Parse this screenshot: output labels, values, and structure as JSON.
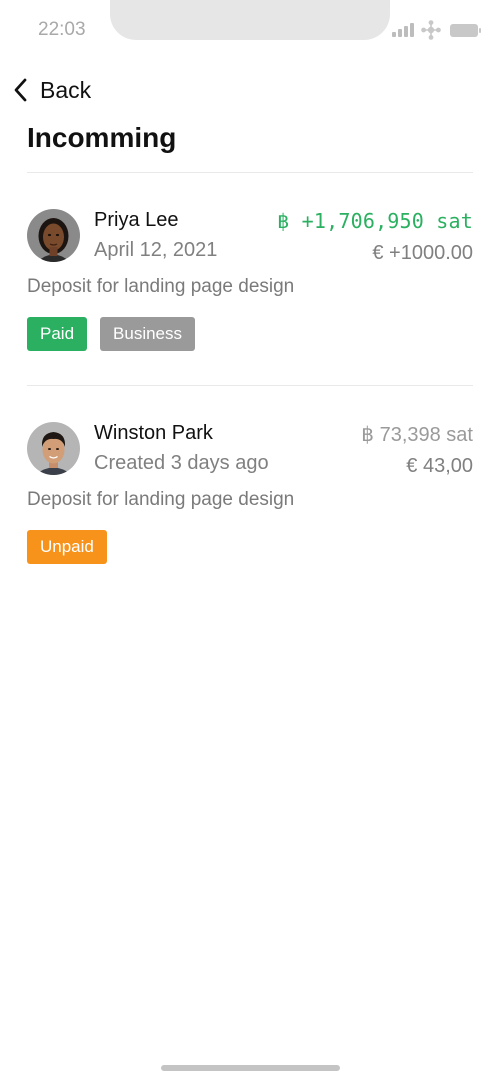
{
  "status_bar": {
    "time": "22:03"
  },
  "header": {
    "back_label": "Back",
    "title": "Incomming"
  },
  "transactions": [
    {
      "name": "Priya Lee",
      "date": "April 12, 2021",
      "amount_btc": "฿ +1,706,950 sat",
      "amount_fiat": "€ +1000.00",
      "description": "Deposit for landing page design",
      "tags": [
        "Paid",
        "Business"
      ],
      "amount_color": "#2bb061"
    },
    {
      "name": "Winston Park",
      "date": "Created 3 days ago",
      "amount_btc": "฿ 73,398 sat",
      "amount_fiat": "€ 43,00",
      "description": "Deposit for landing page design",
      "tags": [
        "Unpaid"
      ],
      "amount_color": "#9a9a9a"
    }
  ],
  "colors": {
    "paid": "#2bb061",
    "business": "#9a9a9a",
    "unpaid": "#f7931a"
  }
}
